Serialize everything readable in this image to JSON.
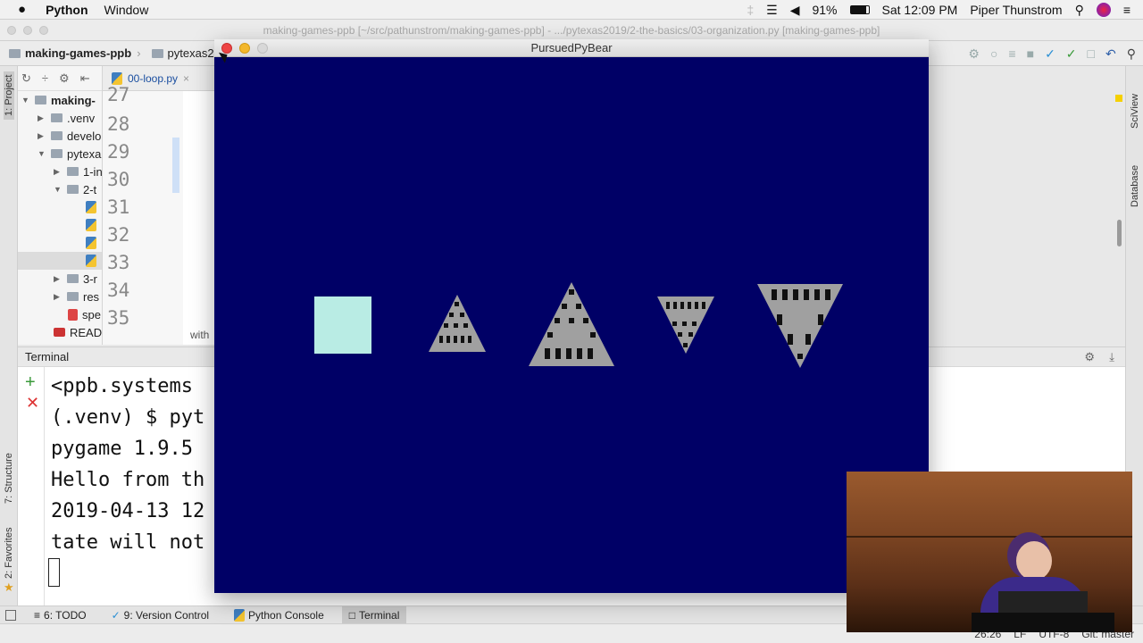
{
  "menubar": {
    "app": "Python",
    "menu_window": "Window",
    "battery": "91%",
    "datetime": "Sat 12:09 PM",
    "user": "Piper Thunstrom"
  },
  "ide": {
    "title": "making-games-ppb [~/src/pathunstrom/making-games-ppb] - .../pytexas2019/2-the-basics/03-organization.py [making-games-ppb]",
    "breadcrumb_root": "making-games-ppb",
    "breadcrumb_child": "pytexas20",
    "tab_label": "00-loop.py",
    "project": {
      "root": "making-",
      "items": [
        {
          "label": ".venv"
        },
        {
          "label": "develo"
        },
        {
          "label": "pytexa"
        },
        {
          "label": "1-in"
        },
        {
          "label": "2-t"
        },
        {
          "label": "3-r"
        },
        {
          "label": "res"
        },
        {
          "label": "spe"
        },
        {
          "label": "READI"
        }
      ]
    },
    "line_numbers": [
      "27",
      "28",
      "29",
      "30",
      "31",
      "32",
      "33",
      "34",
      "35"
    ],
    "editor_hint": "with"
  },
  "terminal": {
    "header": "Terminal",
    "lines": [
      " <ppb.systems",
      "(.venv) $ pyt",
      "pygame 1.9.5",
      "Hello from th",
      "2019-04-13 12",
      "tate will not"
    ]
  },
  "toolwindows": {
    "left_project": "1: Project",
    "left_structure": "7: Structure",
    "left_favorites": "2: Favorites",
    "right_sciview": "SciView",
    "right_database": "Database"
  },
  "bottom_tabs": [
    {
      "label": "6: TODO"
    },
    {
      "label": "9: Version Control"
    },
    {
      "label": "Python Console"
    },
    {
      "label": "Terminal"
    }
  ],
  "status": {
    "position": "26:26",
    "line_sep": "LF",
    "encoding": "UTF-8",
    "vcs": "Git: master"
  },
  "game": {
    "title": "PursuedPyBear",
    "background": "#000066",
    "player_color": "#b9ece4",
    "enemy_color": "#a0a0a0"
  }
}
